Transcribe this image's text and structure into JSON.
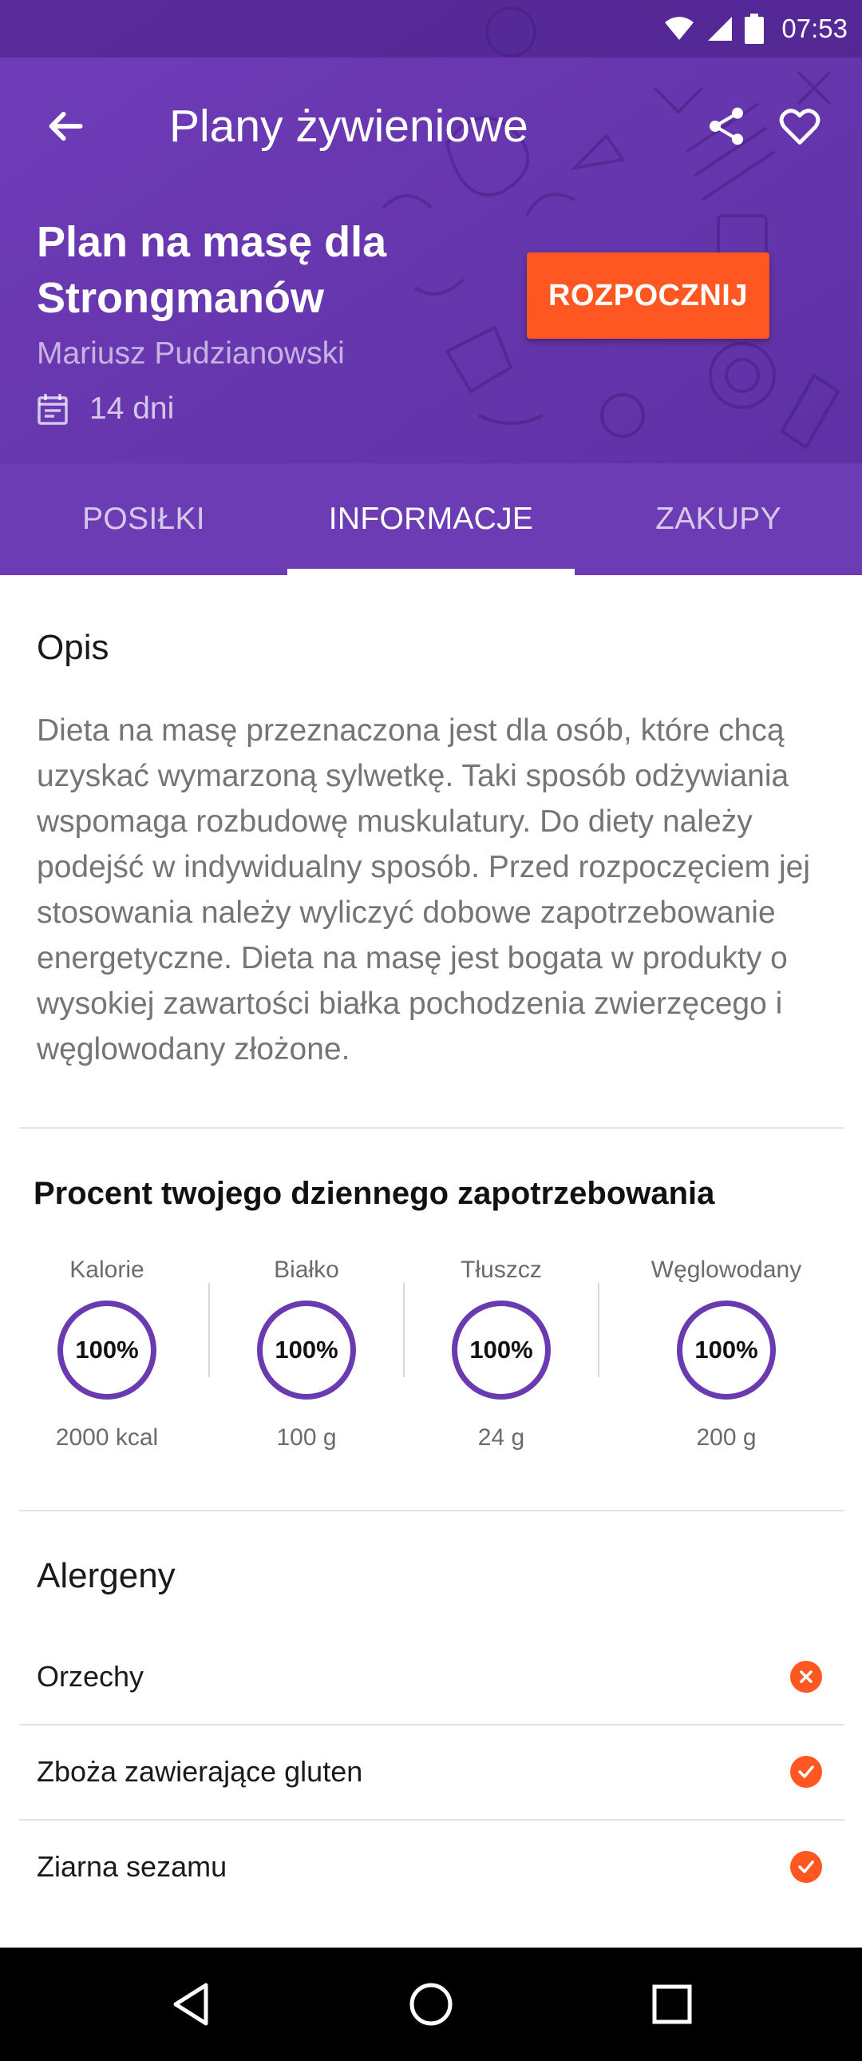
{
  "status_bar": {
    "time": "07:53",
    "icons": [
      "wifi-icon",
      "signal-icon",
      "battery-icon"
    ]
  },
  "app_bar": {
    "title": "Plany żywieniowe",
    "icons": [
      "back-arrow-icon",
      "share-icon",
      "heart-icon"
    ]
  },
  "plan": {
    "title": "Plan na masę dla Strongmanów",
    "author": "Mariusz Pudzianowski",
    "duration": "14 dni",
    "start_label": "ROZPOCZNIJ"
  },
  "tabs": [
    {
      "label": "POSIŁKI",
      "active": false
    },
    {
      "label": "INFORMACJE",
      "active": true
    },
    {
      "label": "ZAKUPY",
      "active": false
    }
  ],
  "description": {
    "title": "Opis",
    "text": "Dieta na masę przeznaczona jest dla osób, które chcą uzyskać wymarzoną sylwetkę. Taki sposób odżywiania wspomaga rozbudowę muskulatury. Do diety należy podejść w indywidualny sposób. Przed rozpoczęciem jej stosowania należy wyliczyć dobowe zapotrzebowanie energetyczne. Dieta na masę jest bogata w produkty o wysokiej zawartości białka pochodzenia zwierzęcego i węglowodany złożone."
  },
  "nutrition": {
    "title": "Procent twojego dziennego zapotrzebowania",
    "items": [
      {
        "label": "Kalorie",
        "percent": "100%",
        "value": "2000 kcal"
      },
      {
        "label": "Białko",
        "percent": "100%",
        "value": "100 g"
      },
      {
        "label": "Tłuszcz",
        "percent": "100%",
        "value": "24 g"
      },
      {
        "label": "Węglowodany",
        "percent": "100%",
        "value": "200 g"
      }
    ]
  },
  "allergens": {
    "title": "Alergeny",
    "items": [
      {
        "name": "Orzechy",
        "status": "excluded",
        "icon": "close-circle-icon"
      },
      {
        "name": "Zboża zawierające gluten",
        "status": "included",
        "icon": "check-circle-icon"
      },
      {
        "name": "Ziarna sezamu",
        "status": "included",
        "icon": "check-circle-icon"
      }
    ]
  },
  "colors": {
    "primary": "#6a3ab0",
    "accent": "#ff5722",
    "text_secondary": "#757575"
  },
  "nav_bar": {
    "icons": [
      "back-triangle-icon",
      "home-circle-icon",
      "recents-square-icon"
    ]
  }
}
